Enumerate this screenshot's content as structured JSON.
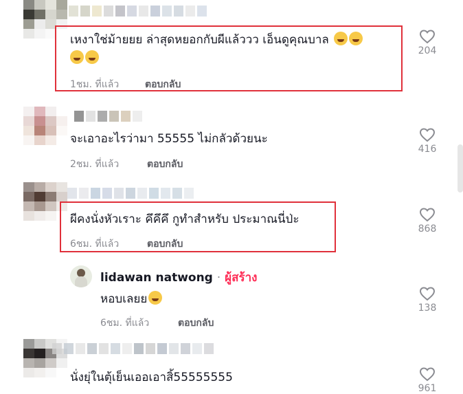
{
  "comments": [
    {
      "text_line1": "เหงาใช่ม้ายยย ล่าสุดหยอกกับผีแล้ววว เอ็นดูคุณบาล",
      "time": "1ชม. ที่แล้ว",
      "reply_label": "ตอบกลับ",
      "likes": "204",
      "emoji_line1": "face-with-tears-of-joy",
      "emoji_line2": "face-with-tears-of-joy"
    },
    {
      "text": "จะเอาอะไรว่ามา 55555 ไม่กลัวด้วยนะ",
      "time": "2ชม. ที่แล้ว",
      "reply_label": "ตอบกลับ",
      "likes": "416"
    },
    {
      "text": "ผีคงนั่งหัวเราะ คึคึคึ กูทำสำหรับ ประมาณนี่ป่ะ",
      "time": "6ชม. ที่แล้ว",
      "reply_label": "ตอบกลับ",
      "likes": "868"
    },
    {
      "text": "นั่งยุ่ในตุ้เย็นเออเอาสิ้55555555",
      "likes": "961"
    }
  ],
  "creator_reply": {
    "name": "lidawan natwong",
    "separator": "·",
    "badge": "ผู้สร้าง",
    "text": "หอบเลยย",
    "emoji": "smiling-face-with-sweat",
    "time": "6ชม. ที่แล้ว",
    "reply_label": "ตอบกลับ",
    "likes": "138"
  },
  "colors": {
    "highlight_border": "#e0303a",
    "creator_badge": "#fe2c55",
    "meta_text": "#8a8b91"
  }
}
